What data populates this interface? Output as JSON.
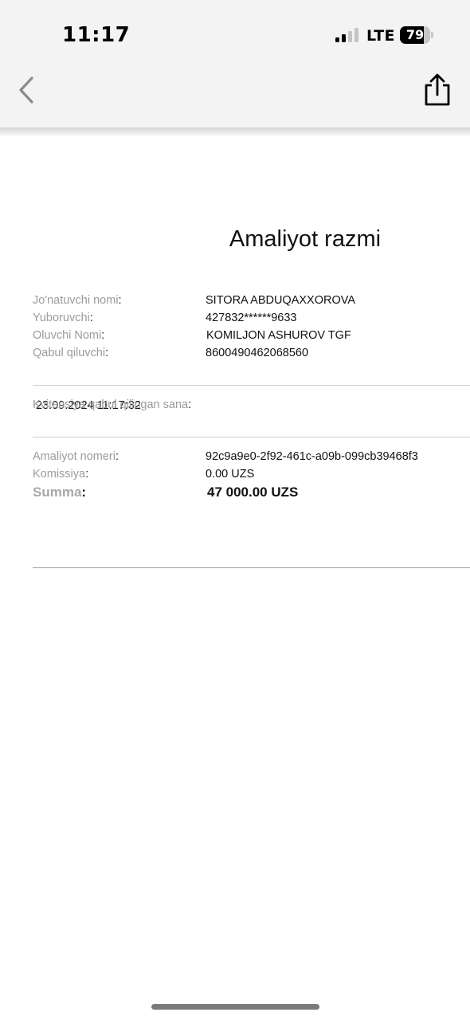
{
  "status_bar": {
    "time": "11:17",
    "network": "LTE",
    "battery": "79",
    "battery_level": 0.79
  },
  "nav": {
    "back_icon": "chevron-left-icon",
    "share_icon": "share-icon"
  },
  "receipt": {
    "title": "Amaliyot razmi",
    "parties": [
      {
        "label": "Jo'natuvchi nomi",
        "value": "SITORA ABDUQAXXOROVA"
      },
      {
        "label": "Yuboruvchi",
        "value": "427832******9633"
      },
      {
        "label": "Oluvchi Nomi",
        "value": "KOMILJON ASHUROV TGF"
      },
      {
        "label": "Qabul qiluvchi",
        "value": "8600490462068560"
      }
    ],
    "date_row": {
      "label": "Kvitansiya qabul qilingan sana",
      "value": "23.09.2024 11:17:32"
    },
    "details": [
      {
        "label": "Amaliyot nomeri",
        "value": "92c9a9e0-2f92-461c-a09b-099cb39468f3"
      },
      {
        "label": "Komissiya",
        "value": "0.00 UZS"
      }
    ],
    "total": {
      "label": "Summa",
      "value": "47 000.00 UZS"
    },
    "colon": ":"
  }
}
